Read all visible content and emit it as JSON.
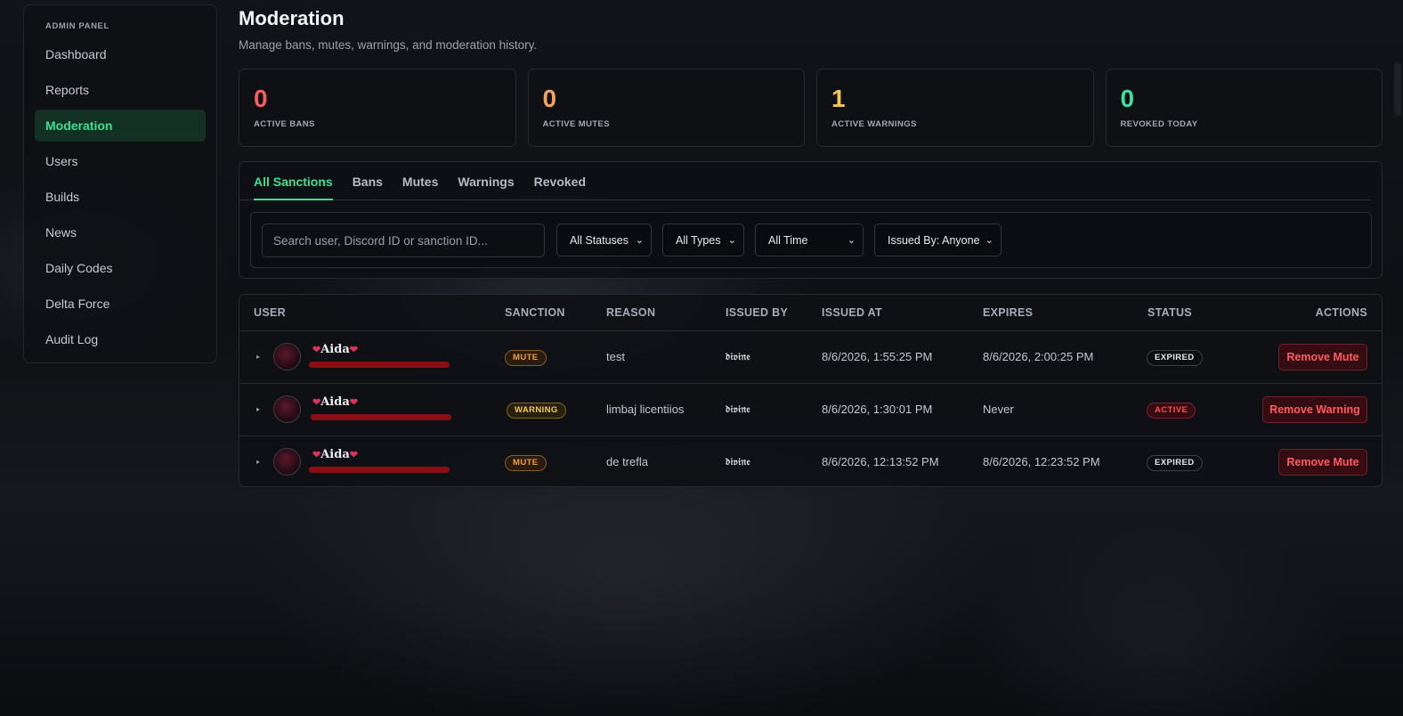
{
  "sidebar": {
    "caption": "ADMIN PANEL",
    "items": [
      {
        "label": "Dashboard"
      },
      {
        "label": "Reports"
      },
      {
        "label": "Moderation",
        "active": true
      },
      {
        "label": "Users"
      },
      {
        "label": "Builds"
      },
      {
        "label": "News"
      },
      {
        "label": "Daily Codes"
      },
      {
        "label": "Delta Force"
      },
      {
        "label": "Audit Log"
      }
    ]
  },
  "header": {
    "title": "Moderation",
    "subtitle": "Manage bans, mutes, warnings, and moderation history."
  },
  "stats": [
    {
      "value": "0",
      "label": "ACTIVE BANS",
      "color": "#f25f5c"
    },
    {
      "value": "0",
      "label": "ACTIVE MUTES",
      "color": "#f5a25d"
    },
    {
      "value": "1",
      "label": "ACTIVE WARNINGS",
      "color": "#f2c94c"
    },
    {
      "value": "0",
      "label": "REVOKED TODAY",
      "color": "#3ee0a0"
    }
  ],
  "tabs": [
    "All Sanctions",
    "Bans",
    "Mutes",
    "Warnings",
    "Revoked"
  ],
  "filters": {
    "search_placeholder": "Search user, Discord ID or sanction ID...",
    "status": "All Statuses",
    "type": "All Types",
    "time": "All Time",
    "issued_by": "Issued By: Anyone"
  },
  "table": {
    "headers": {
      "user": "USER",
      "sanction": "SANCTION",
      "reason": "REASON",
      "issued_by": "ISSUED BY",
      "issued_at": "ISSUED AT",
      "expires": "EXPIRES",
      "status": "STATUS",
      "actions": "ACTIONS"
    },
    "rows": [
      {
        "user": "Aida",
        "sanction": "MUTE",
        "sanction_type": "mute",
        "reason": "test",
        "issued_by": "𝔡𝔦𝔳𝔦𝔫𝔢",
        "issued_at": "8/6/2026, 1:55:25 PM",
        "expires": "8/6/2026, 2:00:25 PM",
        "status": "EXPIRED",
        "status_type": "expired",
        "action": "Remove Mute"
      },
      {
        "user": "Aida",
        "sanction": "WARNING",
        "sanction_type": "warning",
        "reason": "limbaj licentiios",
        "issued_by": "𝔡𝔦𝔳𝔦𝔫𝔢",
        "issued_at": "8/6/2026, 1:30:01 PM",
        "expires": "Never",
        "status": "ACTIVE",
        "status_type": "active",
        "action": "Remove Warning"
      },
      {
        "user": "Aida",
        "sanction": "MUTE",
        "sanction_type": "mute",
        "reason": "de trefla",
        "issued_by": "𝔡𝔦𝔳𝔦𝔫𝔢",
        "issued_at": "8/6/2026, 12:13:52 PM",
        "expires": "8/6/2026, 12:23:52 PM",
        "status": "EXPIRED",
        "status_type": "expired",
        "action": "Remove Mute"
      }
    ]
  }
}
